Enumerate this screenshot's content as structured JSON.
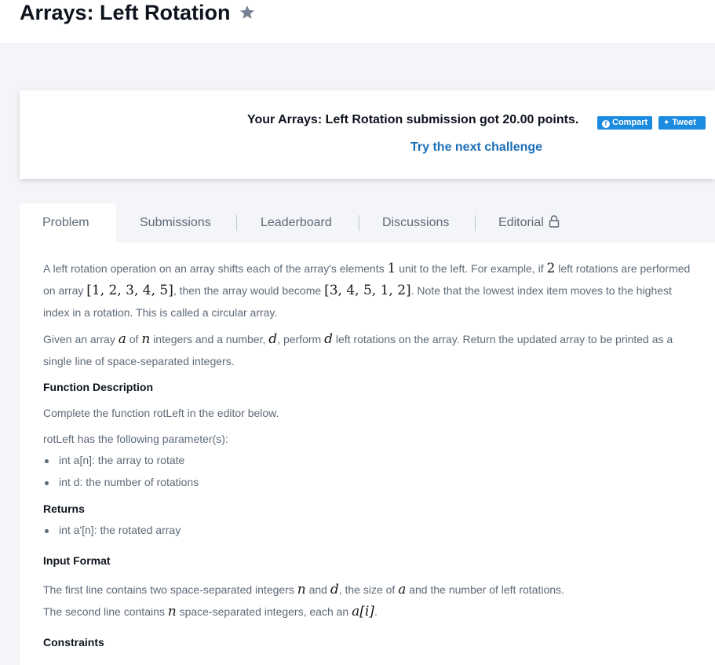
{
  "header": {
    "title": "Arrays: Left Rotation",
    "star_icon": "star-icon"
  },
  "banner": {
    "message": "Your Arrays: Left Rotation submission got 20.00 points.",
    "share_facebook": "Compart",
    "share_twitter": "Tweet",
    "next_link": "Try the next challenge",
    "colors": {
      "share": "#1b8be0",
      "link": "#1b6fb8"
    }
  },
  "tabs": [
    {
      "label": "Problem",
      "active": true
    },
    {
      "label": "Submissions",
      "active": false
    },
    {
      "label": "Leaderboard",
      "active": false
    },
    {
      "label": "Discussions",
      "active": false
    },
    {
      "label": "Editorial",
      "active": false,
      "icon": "lock-icon"
    }
  ],
  "problem": {
    "p1_a": "A left rotation operation on an array shifts each of the array's elements ",
    "p1_m1": "1",
    "p1_b": " unit to the left. For example, if ",
    "p1_m2": "2",
    "p1_c": " left rotations are performed on array ",
    "p1_m3": "[1, 2, 3, 4, 5]",
    "p1_d": ", then the array would become ",
    "p1_m4": "[3, 4, 5, 1, 2]",
    "p1_e": ". Note that the lowest index item moves to the highest index in a rotation. This is called a circular array.",
    "p2_a": "Given an array ",
    "p2_m1": "a",
    "p2_b": " of ",
    "p2_m2": "n",
    "p2_c": " integers and a number, ",
    "p2_m3": "d",
    "p2_d": ", perform ",
    "p2_m4": "d",
    "p2_e": " left rotations on the array. Return the updated array to be printed as a single line of space-separated integers.",
    "function_description_heading": "Function Description",
    "function_description": "Complete the function rotLeft in the editor below.",
    "params_intro": "rotLeft has the following parameter(s):",
    "params": [
      "int a[n]: the array to rotate",
      "int d: the number of rotations"
    ],
    "returns_heading": "Returns",
    "returns": [
      "int a'[n]: the rotated array"
    ],
    "input_format_heading": "Input Format",
    "if1_a": "The first line contains two space-separated integers ",
    "if1_m1": "n",
    "if1_b": " and ",
    "if1_m2": "d",
    "if1_c": ", the size of ",
    "if1_m3": "a",
    "if1_d": " and the number of left rotations.",
    "if2_a": "The second line contains ",
    "if2_m1": "n",
    "if2_b": " space-separated integers, each an ",
    "if2_m2": "a[i]",
    "if2_c": ".",
    "constraints_heading": "Constraints"
  }
}
